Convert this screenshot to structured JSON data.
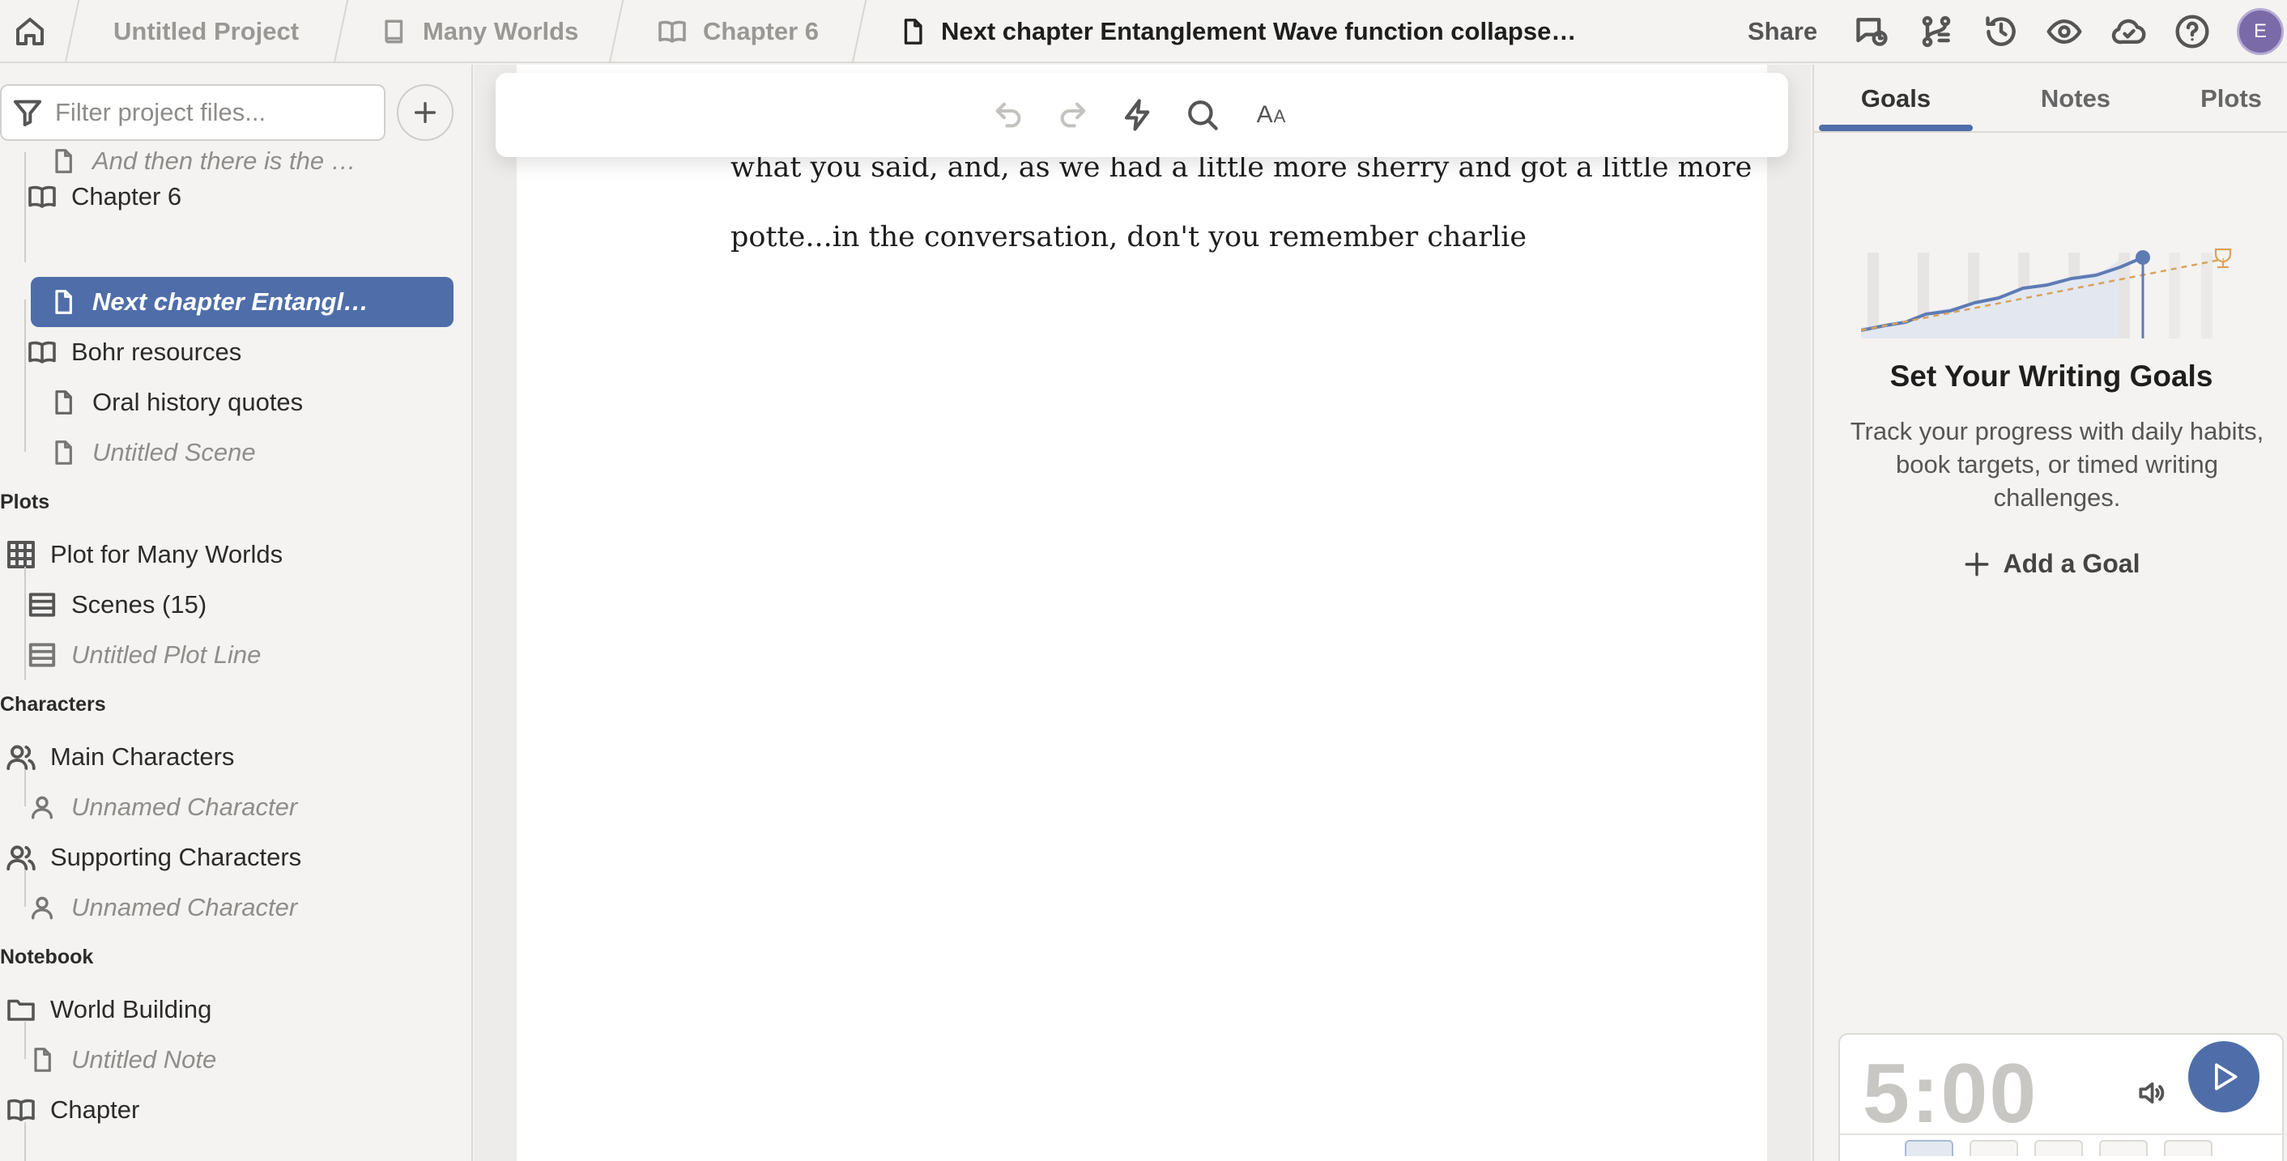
{
  "topbar": {
    "breadcrumbs": [
      {
        "label": "Untitled Project",
        "icon": "none"
      },
      {
        "label": "Many Worlds",
        "icon": "book-closed-icon"
      },
      {
        "label": "Chapter 6",
        "icon": "book-open-icon"
      },
      {
        "label": "Next chapter Entanglement Wave function collapse…",
        "icon": "document-icon"
      }
    ],
    "share_label": "Share",
    "avatar_initial": "E"
  },
  "sidebar": {
    "filter_placeholder": "Filter project files...",
    "items": [
      {
        "label": "And then there is the …",
        "icon": "document-icon",
        "style": "italic"
      },
      {
        "label": "Chapter 6",
        "icon": "book-open-icon",
        "style": "normal"
      },
      {
        "label": "Next chapter Entangl…",
        "icon": "document-icon",
        "style": "selected"
      },
      {
        "label": "Bohr resources",
        "icon": "book-open-icon",
        "style": "normal"
      },
      {
        "label": "Oral history quotes",
        "icon": "document-icon",
        "style": "normal"
      },
      {
        "label": "Untitled Scene",
        "icon": "document-icon",
        "style": "italic"
      }
    ],
    "sections": {
      "plots": {
        "title": "Plots",
        "items": [
          {
            "label": "Plot for Many Worlds",
            "icon": "grid-icon",
            "style": "normal"
          },
          {
            "label": "Scenes (15)",
            "icon": "rows-icon",
            "style": "normal"
          },
          {
            "label": "Untitled Plot Line",
            "icon": "rows-icon",
            "style": "italic"
          }
        ]
      },
      "characters": {
        "title": "Characters",
        "items": [
          {
            "label": "Main Characters",
            "icon": "users-icon",
            "style": "normal"
          },
          {
            "label": "Unnamed Character",
            "icon": "user-icon",
            "style": "italic"
          },
          {
            "label": "Supporting Characters",
            "icon": "users-icon",
            "style": "normal"
          },
          {
            "label": "Unnamed Character",
            "icon": "user-icon",
            "style": "italic"
          }
        ]
      },
      "notebook": {
        "title": "Notebook",
        "items": [
          {
            "label": "World Building",
            "icon": "folder-icon",
            "style": "normal"
          },
          {
            "label": "Untitled Note",
            "icon": "document-icon",
            "style": "italic"
          },
          {
            "label": "Chapter",
            "icon": "book-open-icon",
            "style": "normal"
          }
        ]
      }
    }
  },
  "editor": {
    "paragraphs": [
      "what you said, and, as we had a little more sherry and got a little more",
      "potte...in the conversation, don't you remember charlie"
    ],
    "font_size_label_big": "A",
    "font_size_label_small": "A"
  },
  "right_panel": {
    "tabs": [
      {
        "label": "Goals",
        "active": true
      },
      {
        "label": "Notes",
        "active": false
      },
      {
        "label": "Plots",
        "active": false
      }
    ],
    "goal_title": "Set Your Writing Goals",
    "goal_description": "Track your progress with daily habits, book targets, or timed writing challenges.",
    "add_goal_label": "Add a Goal",
    "timer_value": "5:00"
  },
  "colors": {
    "accent": "#4f6ea9",
    "background": "#f4f3f1",
    "goal_target_line": "#d9a25c"
  }
}
